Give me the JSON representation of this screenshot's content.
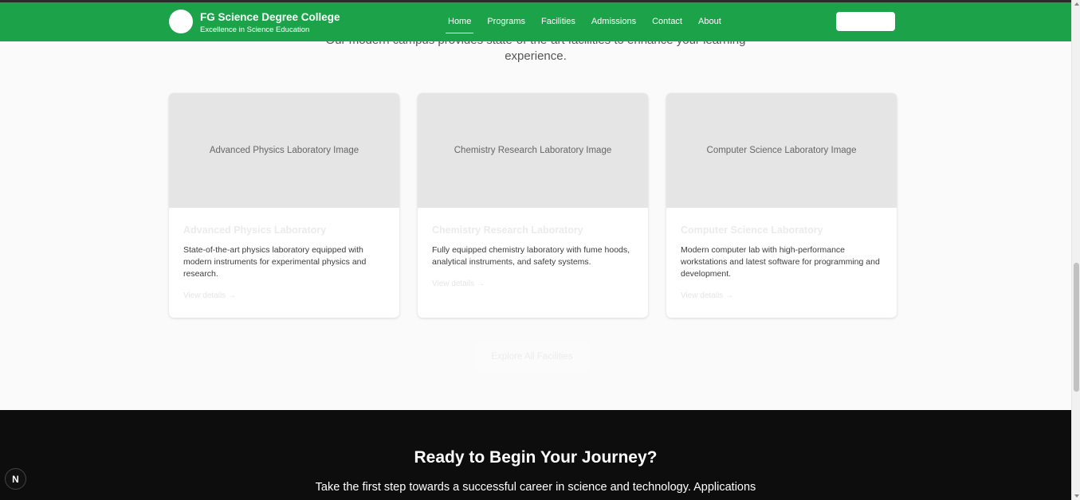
{
  "header": {
    "brand_name": "FG Science Degree College",
    "brand_tagline": "Excellence in Science Education",
    "nav": [
      "Home",
      "Programs",
      "Facilities",
      "Admissions",
      "Contact",
      "About"
    ],
    "active_nav": "Home",
    "header_button_label": ""
  },
  "facilities": {
    "intro_line1": "Our modern campus provides state-of-the-art facilities to enhance your learning",
    "intro_line2": "experience.",
    "cards": [
      {
        "image_alt": "Advanced Physics Laboratory Image",
        "title": "Advanced Physics Laboratory",
        "description": "State-of-the-art physics laboratory equipped with modern instruments for experimental physics and research.",
        "link": "View details →"
      },
      {
        "image_alt": "Chemistry Research Laboratory Image",
        "title": "Chemistry Research Laboratory",
        "description": "Fully equipped chemistry laboratory with fume hoods, analytical instruments, and safety systems.",
        "link": "View details →"
      },
      {
        "image_alt": "Computer Science Laboratory Image",
        "title": "Computer Science Laboratory",
        "description": "Modern computer lab with high-performance workstations and latest software for programming and development.",
        "link": "View details →"
      }
    ],
    "explore_button": "Explore All Facilities"
  },
  "cta": {
    "title": "Ready to Begin Your Journey?",
    "text": "Take the first step towards a successful career in science and technology. Applications"
  },
  "fab_label": "N",
  "colors": {
    "brand_green": "#1ca34a",
    "cta_background": "#0d0d0d"
  }
}
